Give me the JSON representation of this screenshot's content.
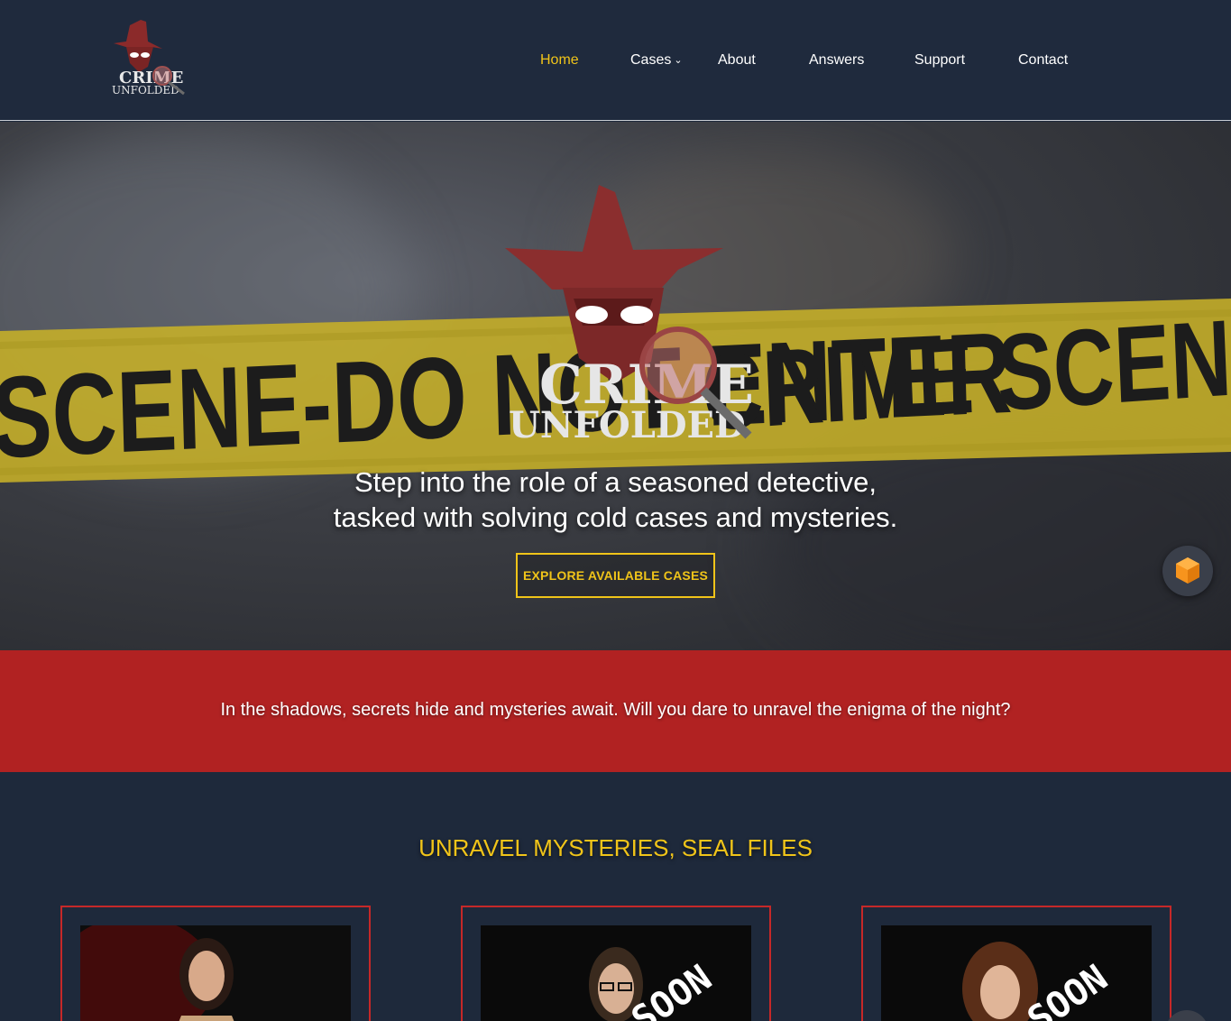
{
  "header": {
    "logo_alt": "Crime Unfolded",
    "logo_text_line1": "CRIME",
    "logo_text_line2": "UNFOLDED"
  },
  "nav": {
    "items": [
      {
        "label": "Home",
        "active": true
      },
      {
        "label": "Cases",
        "has_dropdown": true
      },
      {
        "label": "About"
      },
      {
        "label": "Answers"
      },
      {
        "label": "Support"
      },
      {
        "label": "Contact"
      }
    ]
  },
  "hero": {
    "tape_text_left": "SCENE-DO NOT ENTER",
    "tape_text_right": "CRIME SCENE-DO NO",
    "logo_line1": "CRIME",
    "logo_line2": "UNFOLDED",
    "tagline_line1": "Step into the role of a seasoned detective,",
    "tagline_line2": "tasked with solving cold cases and mysteries.",
    "cta_label": "EXPLORE AVAILABLE CASES"
  },
  "band": {
    "text": "In the shadows, secrets hide and mysteries await. Will you dare to unravel the enigma of the night?"
  },
  "cases": {
    "title": "UNRAVEL MYSTERIES, SEAL FILES",
    "cards": [
      {
        "overlay_text": ""
      },
      {
        "overlay_text": "SOON"
      },
      {
        "overlay_text": "SOON"
      }
    ]
  },
  "colors": {
    "header_bg": "#1f2a3d",
    "accent_yellow": "#f0c419",
    "band_red": "#b12222",
    "card_border": "#c62828",
    "page_bg": "#1e293b"
  },
  "icons": {
    "nav_dropdown": "chevron-down-icon",
    "widget": "cube-icon",
    "logo": "detective-hat-icon"
  }
}
